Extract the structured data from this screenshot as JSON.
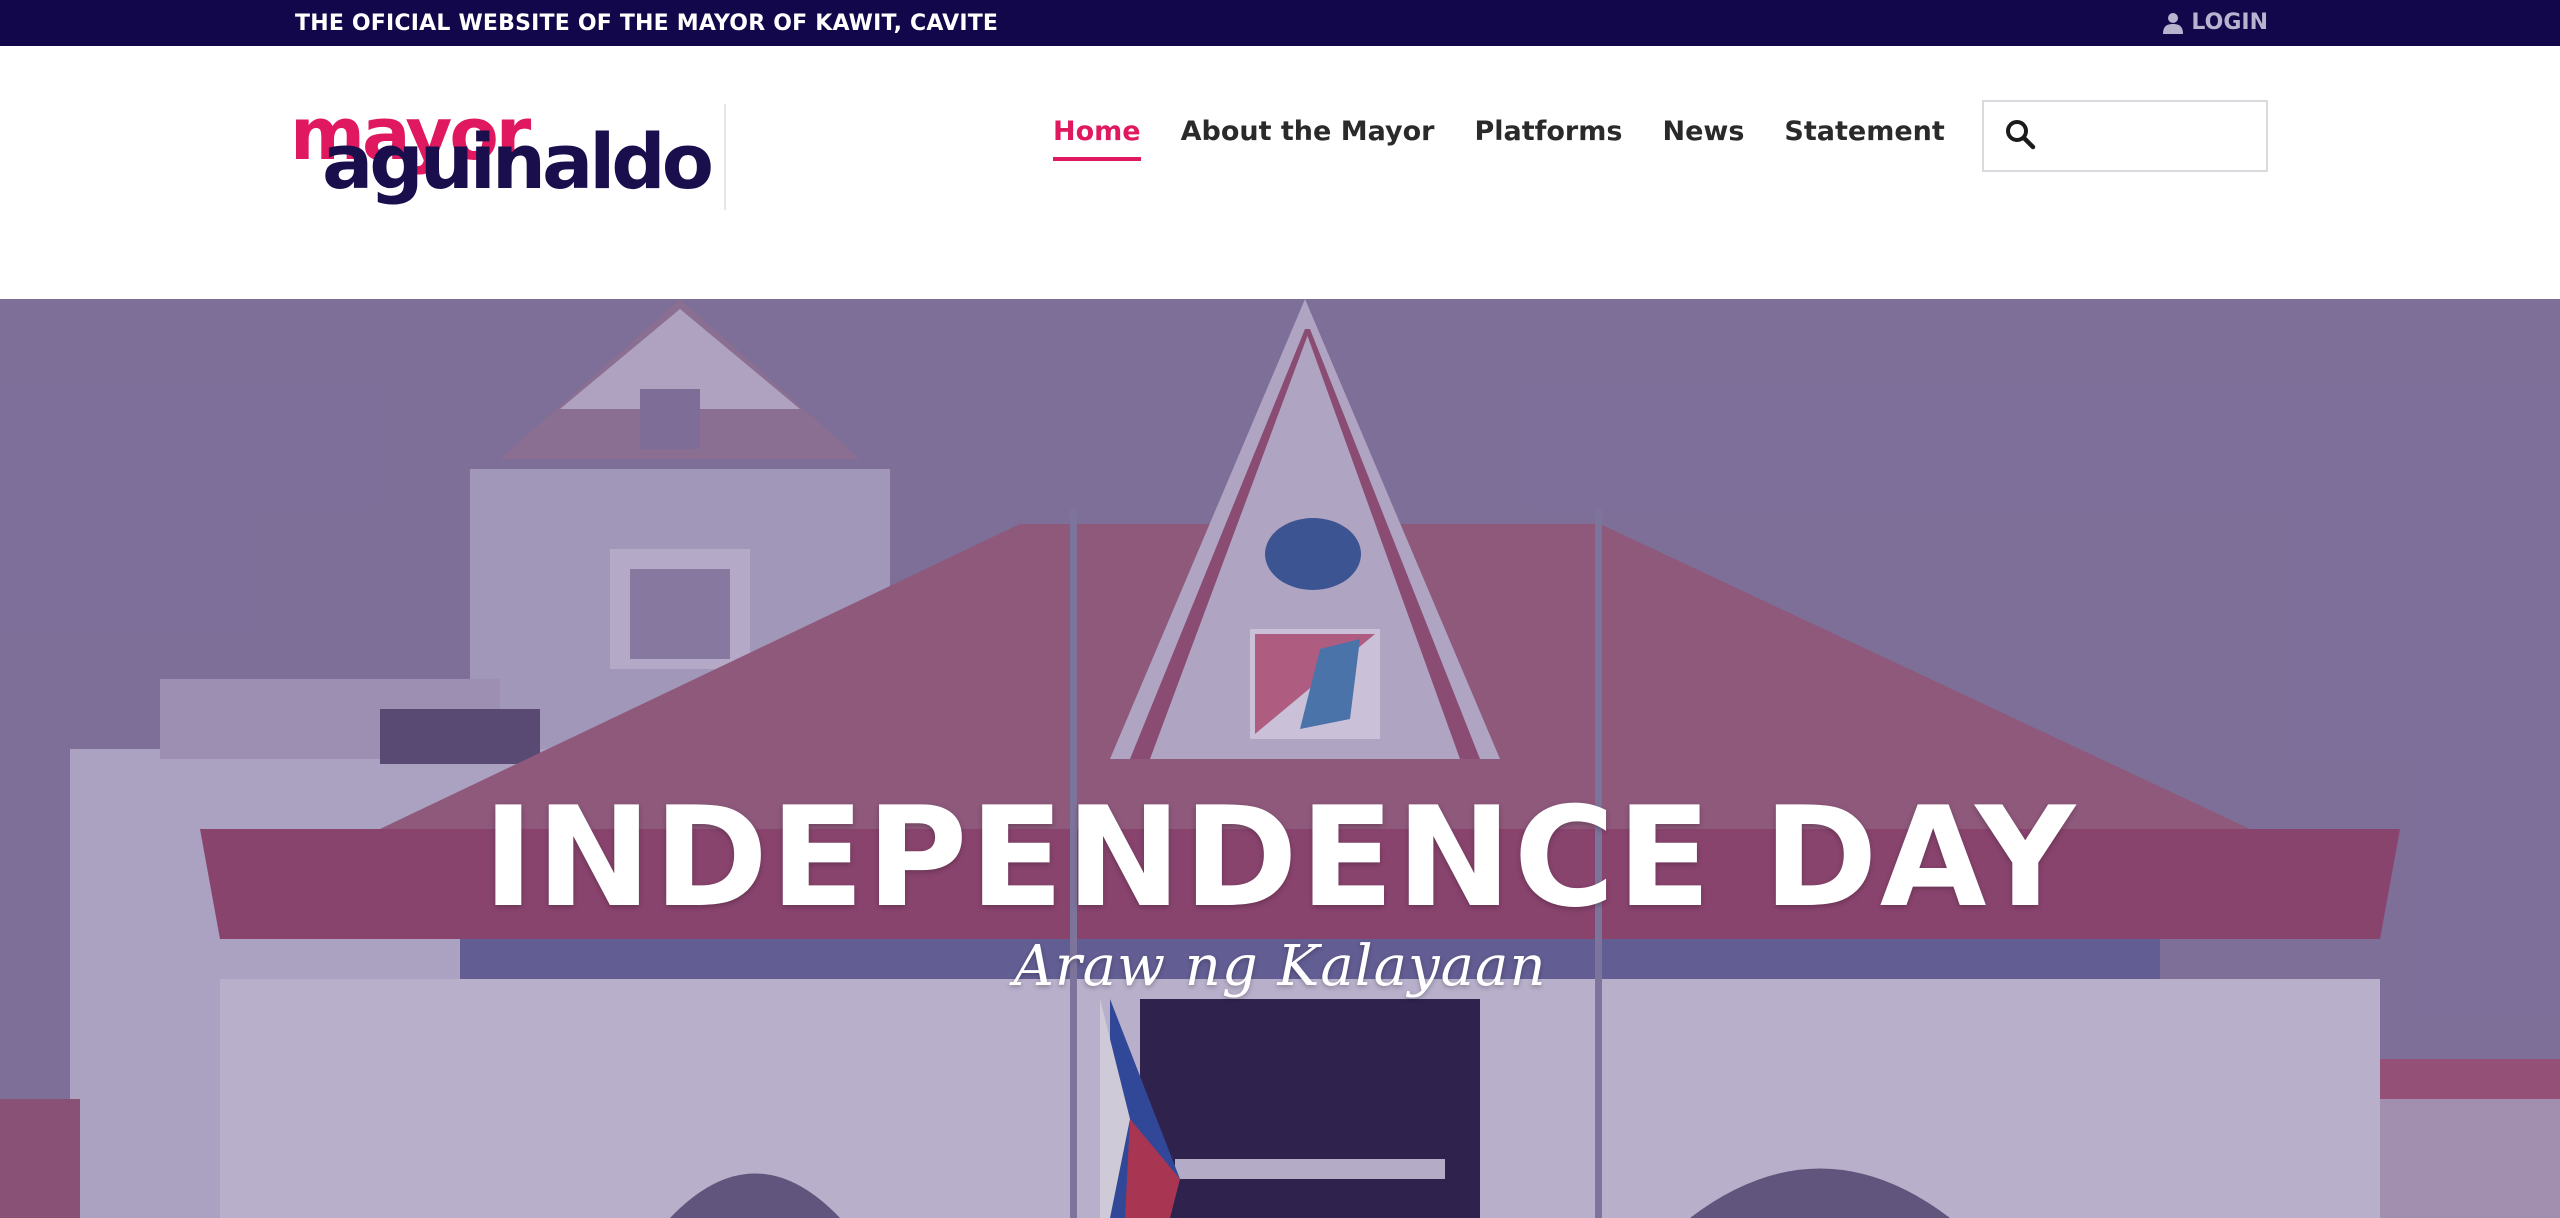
{
  "topbar": {
    "title": "THE OFICIAL WEBSITE OF THE MAYOR OF KAWIT, CAVITE",
    "login_label": "LOGIN"
  },
  "logo": {
    "line1": "mayor",
    "line2": "aguinaldo",
    "color_primary": "#e0185f",
    "color_secondary": "#1a0f4c"
  },
  "nav": {
    "items": [
      {
        "label": "Home",
        "active": true
      },
      {
        "label": "About the Mayor",
        "active": false
      },
      {
        "label": "Platforms",
        "active": false
      },
      {
        "label": "News",
        "active": false
      },
      {
        "label": "Statement",
        "active": false
      }
    ]
  },
  "search": {
    "icon": "search-icon",
    "value": "",
    "placeholder": ""
  },
  "hero": {
    "title": "INDEPENDENCE DAY",
    "subtitle": "Araw ng Kalayaan"
  },
  "colors": {
    "topbar_bg": "#12074a",
    "accent": "#e0185f",
    "nav_text": "#2a2a2a"
  }
}
